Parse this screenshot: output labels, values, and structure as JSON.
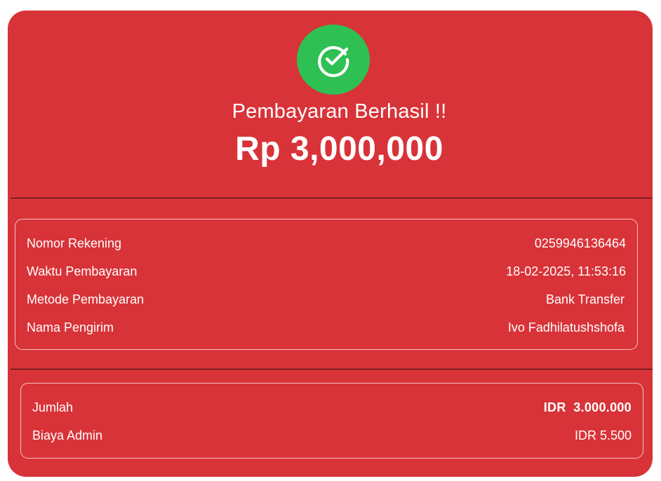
{
  "status": {
    "title": "Pembayaran Berhasil !!",
    "amount": "Rp 3,000,000",
    "icon": "check-circle-icon",
    "icon_color": "#2fc053"
  },
  "theme": {
    "card_bg": "#d83338",
    "text": "#ffffff"
  },
  "details": [
    {
      "label": "Nomor Rekening",
      "value": "0259946136464"
    },
    {
      "label": "Waktu Pembayaran",
      "value": "18-02-2025, 11:53:16"
    },
    {
      "label": "Metode Pembayaran",
      "value": "Bank Transfer"
    },
    {
      "label": "Nama Pengirim",
      "value": "Ivo Fadhilatushshofa"
    }
  ],
  "summary": [
    {
      "label": "Jumlah",
      "value": "IDR  3.000.000"
    },
    {
      "label": "Biaya Admin",
      "value": "IDR 5.500"
    }
  ]
}
